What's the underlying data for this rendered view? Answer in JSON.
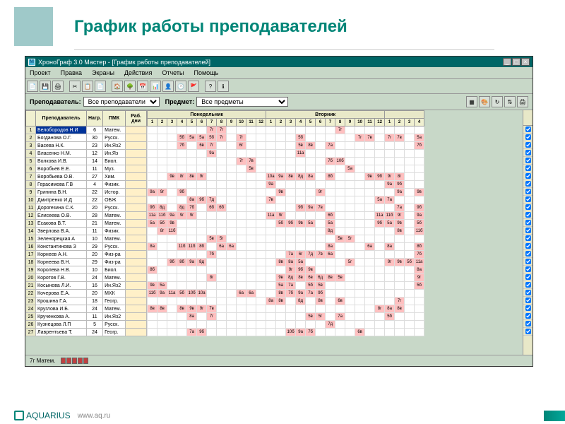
{
  "page": {
    "title": "График работы преподавателей",
    "footer_brand": "AQUARIUS",
    "footer_url": "www.aq.ru"
  },
  "window": {
    "title_icon": "М",
    "title": "ХроноГраф 3.0 Мастер - [График работы преподавателей]"
  },
  "menu": {
    "items": [
      "Проект",
      "Правка",
      "Экраны",
      "Действия",
      "Отчеты",
      "Помощь"
    ]
  },
  "toolbar_icons": [
    "file",
    "save",
    "print",
    "sep",
    "cut",
    "copy",
    "paste",
    "sep",
    "home",
    "tree",
    "calendar",
    "chart",
    "person",
    "clock",
    "flag",
    "sep",
    "help",
    "about"
  ],
  "filter": {
    "teacher_label": "Преподаватель:",
    "teacher_value": "Все преподаватели",
    "subject_label": "Предмет:",
    "subject_value": "Все предметы"
  },
  "filter_icons_right": [
    "grid",
    "color",
    "refresh",
    "sort",
    "print"
  ],
  "columns": {
    "teacher": "Преподаватель",
    "load": "Нагр.",
    "pmk": "ПМК",
    "days": "Раб. дни"
  },
  "day_headers": [
    "Понедельник",
    "Вторник",
    ""
  ],
  "periods_per_day": 12,
  "extra_periods": 4,
  "teachers": [
    {
      "n": 1,
      "name": "Белобородов Н.И",
      "load": 6,
      "subj": "Матем.",
      "sel": true,
      "cells": [
        "",
        "",
        "",
        "",
        "",
        "",
        "7г",
        "7г",
        "",
        "",
        "",
        "",
        "",
        "",
        "",
        "",
        "",
        "",
        "",
        "7г",
        "",
        "",
        "",
        "",
        "",
        "",
        "",
        ""
      ]
    },
    {
      "n": 2,
      "name": "Богданова О.Г.",
      "load": 30,
      "subj": "Русск.",
      "cells": [
        "",
        "",
        "",
        "5б",
        "5а",
        "5а",
        "5б",
        "7г",
        "",
        "7г",
        "",
        "",
        "",
        "",
        "",
        "5б",
        "",
        "",
        "",
        "",
        "",
        "7г",
        "7в",
        "",
        "7г",
        "7в",
        "",
        "5а"
      ]
    },
    {
      "n": 3,
      "name": "Васева Н.К.",
      "load": 23,
      "subj": "Ин.Яз2",
      "cells": [
        "",
        "",
        "",
        "7б",
        "",
        "6в",
        "7г",
        "",
        "",
        "6г",
        "",
        "",
        "",
        "",
        "",
        "5в",
        "8в",
        "",
        "7а",
        "",
        "",
        "",
        "",
        "",
        "",
        "",
        "",
        "7б"
      ]
    },
    {
      "n": 4,
      "name": "Власенко Н.М.",
      "load": 12,
      "subj": "Ин.Яз",
      "cells": [
        "",
        "",
        "",
        "",
        "",
        "",
        "9а",
        "",
        "",
        "",
        "",
        "",
        "",
        "",
        "",
        "11а",
        "",
        "",
        "",
        "",
        "",
        "",
        "",
        "",
        "",
        "",
        "",
        ""
      ]
    },
    {
      "n": 5,
      "name": "Волкова И.В.",
      "load": 14,
      "subj": "Биол.",
      "cells": [
        "",
        "",
        "",
        "",
        "",
        "",
        "",
        "",
        "",
        "7г",
        "7в",
        "",
        "",
        "",
        "",
        "",
        "",
        "",
        "7б",
        "10б",
        "",
        "",
        "",
        "",
        "",
        "",
        "",
        ""
      ]
    },
    {
      "n": 6,
      "name": "Воробьев Е.Е.",
      "load": 11,
      "subj": "Муз.",
      "cells": [
        "",
        "",
        "",
        "",
        "",
        "",
        "",
        "",
        "",
        "",
        "5в",
        "",
        "",
        "",
        "",
        "",
        "",
        "",
        "",
        "",
        "5а",
        "",
        "",
        "",
        "",
        "",
        "",
        ""
      ]
    },
    {
      "n": 7,
      "name": "Воробьева О.В.",
      "load": 27,
      "subj": "Хим.",
      "cells": [
        "",
        "",
        "9в",
        "8г",
        "8в",
        "9г",
        "",
        "",
        "",
        "",
        "",
        "",
        "10а",
        "9а",
        "8в",
        "8д",
        "8а",
        "",
        "8б",
        "",
        "",
        "",
        "9в",
        "9б",
        "9г",
        "8г",
        "",
        ""
      ]
    },
    {
      "n": 8,
      "name": "Герасимова Г.В",
      "load": 4,
      "subj": "Физик.",
      "cells": [
        "",
        "",
        "",
        "",
        "",
        "",
        "",
        "",
        "",
        "",
        "",
        "",
        "9а",
        "",
        "",
        "",
        "",
        "",
        "",
        "",
        "",
        "",
        "",
        "",
        "9а",
        "9б",
        "",
        ""
      ]
    },
    {
      "n": 9,
      "name": "Гринина В.Н.",
      "load": 22,
      "subj": "Истор.",
      "cells": [
        "9а",
        "9г",
        "",
        "9б",
        "",
        "",
        "",
        "",
        "",
        "",
        "",
        "",
        "",
        "9в",
        "",
        "",
        "",
        "9г",
        "",
        "",
        "",
        "",
        "",
        "",
        "",
        "9а",
        "",
        "9в"
      ]
    },
    {
      "n": 10,
      "name": "Дмитренко И.Д",
      "load": 22,
      "subj": "ОБЖ",
      "cells": [
        "",
        "",
        "",
        "",
        "8а",
        "9б",
        "7д",
        "",
        "",
        "",
        "",
        "",
        "7в",
        "",
        "",
        "",
        "",
        "",
        "",
        "",
        "",
        "",
        "",
        "5а",
        "7а",
        "",
        "",
        ""
      ]
    },
    {
      "n": 11,
      "name": "Дорогезина С.К.",
      "load": 20,
      "subj": "Русск.",
      "cells": [
        "9б",
        "8д",
        "",
        "8д",
        "7б",
        "",
        "6б",
        "6б",
        "",
        "",
        "",
        "",
        "",
        "",
        "",
        "9б",
        "9а",
        "7в",
        "",
        "",
        "",
        "",
        "",
        "",
        "",
        "7а",
        "",
        "9б"
      ]
    },
    {
      "n": 12,
      "name": "Елисеева О.В.",
      "load": 28,
      "subj": "Матем.",
      "cells": [
        "11а",
        "11б",
        "9а",
        "9г",
        "9г",
        "",
        "",
        "",
        "",
        "",
        "",
        "",
        "11а",
        "9г",
        "",
        "",
        "",
        "",
        "6б",
        "",
        "",
        "",
        "",
        "11а",
        "11б",
        "9г",
        "",
        "9а"
      ]
    },
    {
      "n": 13,
      "name": "Есакова В.Т.",
      "load": 21,
      "subj": "Матем.",
      "cells": [
        "5а",
        "5б",
        "9в",
        "",
        "",
        "",
        "",
        "",
        "",
        "",
        "",
        "",
        "",
        "5б",
        "9б",
        "9в",
        "5а",
        "",
        "5а",
        "",
        "",
        "",
        "",
        "9б",
        "5а",
        "9в",
        "",
        "5б"
      ]
    },
    {
      "n": 14,
      "name": "Зверлова В.А.",
      "load": 11,
      "subj": "Физик.",
      "cells": [
        "",
        "8г",
        "11б",
        "",
        "",
        "",
        "",
        "",
        "",
        "",
        "",
        "",
        "",
        "",
        "",
        "",
        "",
        "",
        "8д",
        "",
        "",
        "",
        "",
        "",
        "",
        "8в",
        "",
        "11б"
      ]
    },
    {
      "n": 15,
      "name": "Зеленорецкая А",
      "load": 10,
      "subj": "Матем.",
      "cells": [
        "",
        "",
        "",
        "",
        "",
        "",
        "5в",
        "5г",
        "",
        "",
        "",
        "",
        "",
        "",
        "",
        "",
        "",
        "",
        "",
        "5в",
        "5г",
        "",
        "",
        "",
        "",
        "",
        "",
        ""
      ]
    },
    {
      "n": 16,
      "name": "Константинова З",
      "load": 29,
      "subj": "Русск.",
      "cells": [
        "8а",
        "",
        "",
        "11б",
        "11б",
        "8б",
        "",
        "6а",
        "6а",
        "",
        "",
        "",
        "",
        "",
        "",
        "",
        "",
        "",
        "8а",
        "",
        "",
        "",
        "6а",
        "",
        "8а",
        "",
        "",
        "8б"
      ]
    },
    {
      "n": 17,
      "name": "Корнеев А.Н.",
      "load": 20,
      "subj": "Физ-ра",
      "cells": [
        "",
        "",
        "",
        "",
        "",
        "",
        "7б",
        "",
        "",
        "",
        "",
        "",
        "",
        "",
        "7а",
        "6г",
        "7д",
        "7в",
        "6а",
        "",
        "",
        "",
        "",
        "",
        "",
        "",
        "",
        "7б"
      ]
    },
    {
      "n": 18,
      "name": "Корнеева В.Н.",
      "load": 29,
      "subj": "Физ-ра",
      "cells": [
        "",
        "",
        "9б",
        "8б",
        "9а",
        "8д",
        "",
        "",
        "",
        "",
        "",
        "",
        "",
        "8в",
        "8а",
        "5а",
        "",
        "",
        "",
        "",
        "5г",
        "",
        "",
        "",
        "9г",
        "9в",
        "5б",
        "11а"
      ]
    },
    {
      "n": 19,
      "name": "Королева Н.В.",
      "load": 10,
      "subj": "Биол.",
      "cells": [
        "8б",
        "",
        "",
        "",
        "",
        "",
        "",
        "",
        "",
        "",
        "",
        "",
        "",
        "",
        "9г",
        "9б",
        "9в",
        "",
        "",
        "",
        "",
        "",
        "",
        "",
        "",
        "",
        "",
        "8а"
      ]
    },
    {
      "n": 20,
      "name": "Коротов Г.В.",
      "load": 24,
      "subj": "Матем.",
      "cells": [
        "",
        "",
        "",
        "",
        "",
        "",
        "8г",
        "",
        "",
        "",
        "",
        "",
        "",
        "9в",
        "8д",
        "8в",
        "6в",
        "6д",
        "8в",
        "5в",
        "",
        "",
        "",
        "",
        "",
        "",
        "",
        "9г"
      ]
    },
    {
      "n": 21,
      "name": "Косынова Л.И.",
      "load": 16,
      "subj": "Ин.Яз2",
      "cells": [
        "9в",
        "5а",
        "",
        "",
        "",
        "",
        "",
        "",
        "",
        "",
        "",
        "",
        "",
        "5а",
        "7а",
        "",
        "5б",
        "5в",
        "",
        "",
        "",
        "",
        "",
        "",
        "",
        "",
        "",
        "5б"
      ]
    },
    {
      "n": 22,
      "name": "Кочерова Е.А.",
      "load": 20,
      "subj": "МХК",
      "cells": [
        "11б",
        "9а",
        "11а",
        "5б",
        "10б",
        "10а",
        "",
        "",
        "",
        "6а",
        "6а",
        "",
        "",
        "8в",
        "7б",
        "9а",
        "7а",
        "9б",
        "",
        "",
        "",
        "",
        "",
        "",
        "",
        "",
        "",
        ""
      ]
    },
    {
      "n": 23,
      "name": "Крошина Г.А.",
      "load": 18,
      "subj": "Геогр.",
      "cells": [
        "",
        "",
        "",
        "",
        "",
        "",
        "",
        "",
        "",
        "",
        "",
        "",
        "8а",
        "8в",
        "",
        "8д",
        "",
        "8в",
        "",
        "6в",
        "",
        "",
        "",
        "",
        "",
        "7г",
        "",
        "",
        ""
      ]
    },
    {
      "n": 24,
      "name": "Круглова И.Б.",
      "load": 24,
      "subj": "Матем.",
      "cells": [
        "8в",
        "8в",
        "",
        "8в",
        "9в",
        "9г",
        "7в",
        "",
        "",
        "",
        "",
        "",
        "",
        "",
        "",
        "",
        "",
        "",
        "",
        "",
        "",
        "",
        "",
        "8г",
        "8а",
        "8в",
        "",
        ""
      ]
    },
    {
      "n": 25,
      "name": "Крученкова А.",
      "load": 11,
      "subj": "Ин.Яз2",
      "cells": [
        "",
        "",
        "",
        "",
        "8а",
        "",
        "7г",
        "",
        "",
        "",
        "",
        "",
        "",
        "",
        "",
        "",
        "5в",
        "5г",
        "",
        "7а",
        "",
        "",
        "",
        "",
        "5б",
        "",
        "",
        ""
      ]
    },
    {
      "n": 26,
      "name": "Кузнецова Л.П",
      "load": 5,
      "subj": "Русск.",
      "cells": [
        "",
        "",
        "",
        "",
        "",
        "",
        "",
        "",
        "",
        "",
        "",
        "",
        "",
        "",
        "",
        "",
        "",
        "",
        "7д",
        "",
        "",
        "",
        "",
        "",
        "",
        "",
        "",
        ""
      ]
    },
    {
      "n": 27,
      "name": "Лаврентьева Т.",
      "load": 24,
      "subj": "Геогр.",
      "cells": [
        "",
        "",
        "",
        "",
        "7а",
        "9б",
        "",
        "",
        "",
        "",
        "",
        "",
        "",
        "",
        "10б",
        "9а",
        "7б",
        "",
        "",
        "",
        "",
        "6в",
        "",
        "",
        "",
        "",
        "",
        ""
      ]
    }
  ],
  "status": {
    "left": "7г Матем."
  }
}
